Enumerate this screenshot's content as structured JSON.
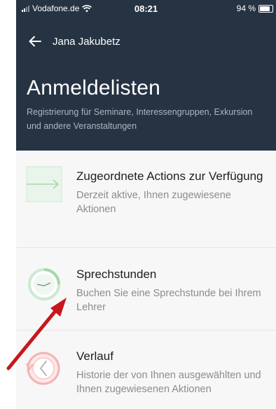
{
  "status_bar": {
    "carrier": "Vodafone.de",
    "time": "08:21",
    "battery": "94 %",
    "battery_level": 0.94
  },
  "header": {
    "back_icon": "arrow-left-icon",
    "user_name": "Jana Jakubetz",
    "title": "Anmeldelisten",
    "subtitle": "Registrierung für Seminare, Interessengruppen, Exkursion und andere Veranstaltungen",
    "background_color": "#263343"
  },
  "menu": {
    "items": [
      {
        "icon": "arrow-right-box-icon",
        "title": "Zugeordnete Actions zur Verfügung",
        "description": "Derzeit aktive, Ihnen zugewiesene Aktionen",
        "icon_color": "#9fd3a8"
      },
      {
        "icon": "clock-icon",
        "title": "Sprechstunden",
        "description": "Buchen Sie eine Sprechstunde bei Ihrem Lehrer",
        "icon_color": "#9fd3a8"
      },
      {
        "icon": "history-icon",
        "title": "Verlauf",
        "description": "Historie der von Ihnen ausgewählten und Ihnen zugewiesenen Aktionen",
        "icon_color": "#f4a6a6"
      }
    ]
  },
  "annotation": {
    "arrow_color": "#c8161d"
  }
}
